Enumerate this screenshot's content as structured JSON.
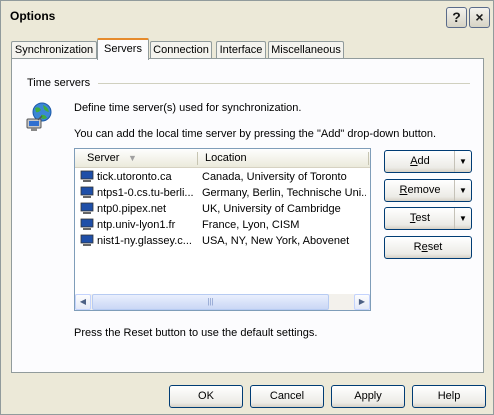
{
  "window": {
    "title": "Options",
    "help_button": "?",
    "close_button": "×"
  },
  "tabs": [
    {
      "label": "Synchronization",
      "active": false
    },
    {
      "label": "Servers",
      "active": true
    },
    {
      "label": "Connection",
      "active": false
    },
    {
      "label": "Interface",
      "active": false
    },
    {
      "label": "Miscellaneous",
      "active": false
    }
  ],
  "servers_tab": {
    "group_label": "Time servers",
    "icon": "globe-network-icon",
    "description_1": "Define time server(s) used for synchronization.",
    "description_2": "You can add the local time server by pressing the \"Add\" drop-down button.",
    "list": {
      "columns": {
        "server": "Server",
        "location": "Location"
      },
      "sorted_by": "server",
      "rows": [
        {
          "server": "tick.utoronto.ca",
          "location": "Canada, University of Toronto"
        },
        {
          "server": "ntps1-0.cs.tu-berli...",
          "location": "Germany, Berlin, Technische Uni..."
        },
        {
          "server": "ntp0.pipex.net",
          "location": "UK, University of Cambridge"
        },
        {
          "server": "ntp.univ-lyon1.fr",
          "location": "France, Lyon, CISM"
        },
        {
          "server": "nist1-ny.glassey.c...",
          "location": "USA, NY,  New York, Abovenet"
        }
      ],
      "row_icon": "server-computer-icon"
    },
    "buttons": {
      "add": {
        "pre": "",
        "mnemonic": "A",
        "post": "dd"
      },
      "remove": {
        "pre": "",
        "mnemonic": "R",
        "post": "emove"
      },
      "test": {
        "pre": "",
        "mnemonic": "T",
        "post": "est"
      },
      "reset": {
        "pre": "R",
        "mnemonic": "e",
        "post": "set"
      }
    },
    "note": "Press the Reset button to use the default settings."
  },
  "footer": {
    "ok": "OK",
    "cancel": "Cancel",
    "apply": "Apply",
    "help": "Help"
  }
}
